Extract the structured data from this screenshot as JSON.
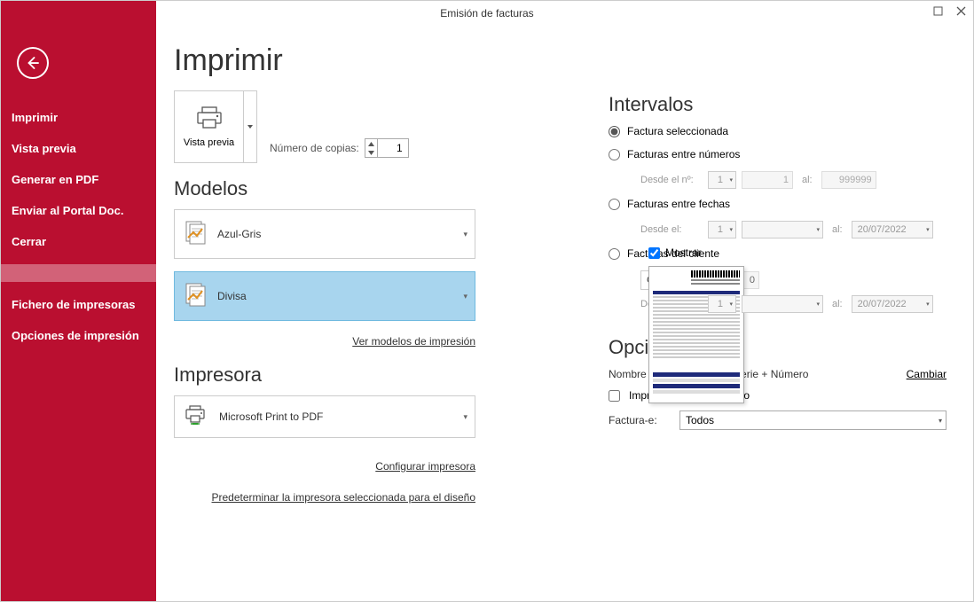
{
  "window": {
    "title": "Emisión de facturas"
  },
  "sidebar": {
    "items": [
      "Imprimir",
      "Vista previa",
      "Generar en PDF",
      "Enviar al Portal Doc.",
      "Cerrar"
    ],
    "items2": [
      "Fichero de impresoras",
      "Opciones de impresión"
    ]
  },
  "page": {
    "title": "Imprimir",
    "preview_button": "Vista previa",
    "copies_label": "Número de copias:",
    "copies_value": "1"
  },
  "models": {
    "heading": "Modelos",
    "items": [
      {
        "name": "Azul-Gris",
        "selected": false
      },
      {
        "name": "Divisa",
        "selected": true
      }
    ],
    "show_label": "Mostrar",
    "show_checked": true,
    "link": "Ver modelos de impresión"
  },
  "printer": {
    "heading": "Impresora",
    "selected": "Microsoft Print to PDF",
    "links": [
      "Configurar impresora",
      "Predeterminar la impresora seleccionada para el diseño"
    ]
  },
  "intervals": {
    "heading": "Intervalos",
    "options": {
      "selected": "Factura seleccionada",
      "between_numbers": "Facturas entre números",
      "between_dates": "Facturas entre fechas",
      "by_client": "Facturas del cliente"
    },
    "from_num_label": "Desde el nº:",
    "num_series": "1",
    "num_from": "1",
    "to_label": "al:",
    "num_to": "999999",
    "from_date_label": "Desde el:",
    "date_series": "1",
    "date_to": "20/07/2022",
    "client_label": "Cliente:",
    "client_value": "0"
  },
  "options": {
    "heading": "Opciones",
    "pdf_name_label": "Nombre .PDF:",
    "pdf_name_value": "Factura + Serie + Número",
    "change_link": "Cambiar",
    "reverse_label": "Imprimir en orden inverso",
    "reverse_checked": false,
    "einvoice_label": "Factura-e:",
    "einvoice_value": "Todos"
  }
}
